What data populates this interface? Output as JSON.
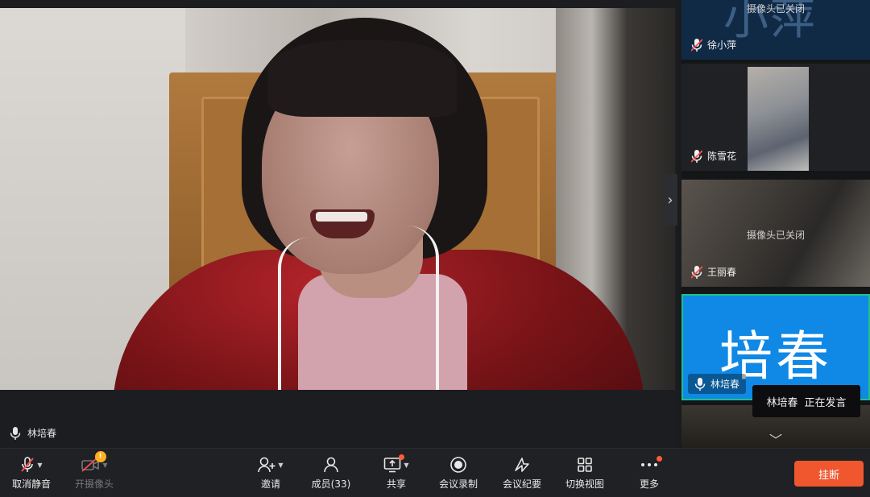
{
  "main": {
    "speaker_name": "林培春"
  },
  "rail": {
    "tiles": [
      {
        "name": "徐小萍",
        "avatar_text": "小萍",
        "status": "摄像头已关闭",
        "muted": true
      },
      {
        "name": "陈雪花",
        "muted": true
      },
      {
        "name": "王丽春",
        "status": "摄像头已关闭",
        "muted": true
      },
      {
        "name": "林培春",
        "avatar_text": "培春",
        "muted": false,
        "active": true
      }
    ],
    "toast_name": "林培春",
    "toast_status": "正在发言"
  },
  "toolbar": {
    "unmute": "取消静音",
    "camera": "开摄像头",
    "camera_badge": "!",
    "invite": "邀请",
    "members": "成员(33)",
    "share": "共享",
    "record": "会议录制",
    "minutes": "会议纪要",
    "switch_view": "切换视图",
    "more": "更多",
    "hangup": "挂断"
  },
  "colors": {
    "active_tile": "#0f88e6",
    "active_border": "#22c08a",
    "hangup": "#f0572f",
    "badge": "#ff5a3c",
    "warning": "#ffb020"
  }
}
